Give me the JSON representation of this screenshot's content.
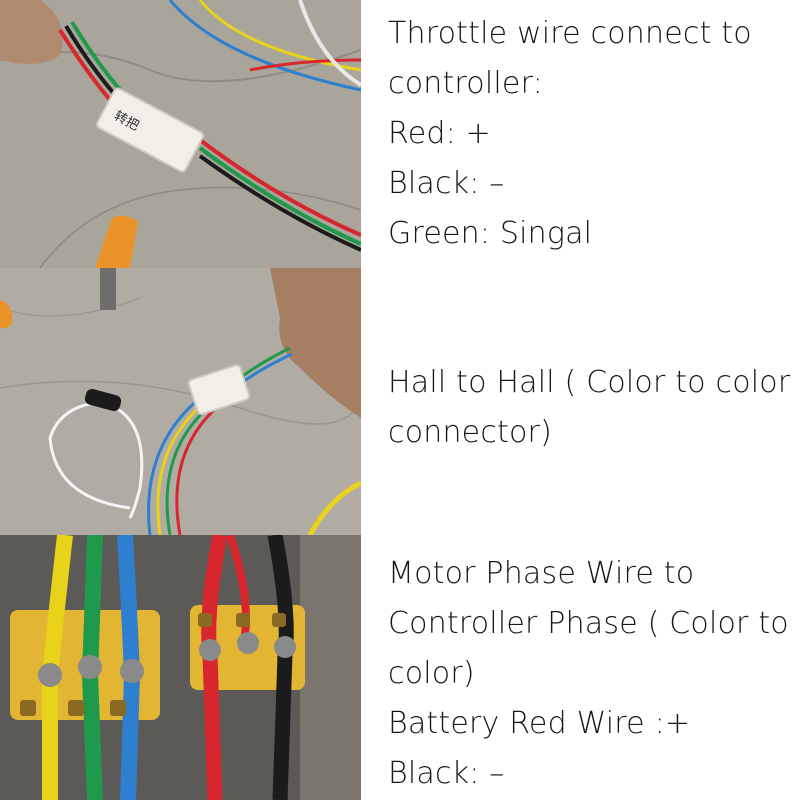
{
  "sections": [
    {
      "lines": [
        "Throttle wire connect to",
        "controller:",
        "Red: +",
        "Black: –",
        "Green: Singal"
      ],
      "photo_script_label": "转把"
    },
    {
      "lines": [
        "Hall to Hall ( Color to color",
        "connector)"
      ]
    },
    {
      "lines": [
        "Motor Phase Wire to",
        "Controller Phase ( Color to",
        "color)",
        "Battery Red Wire :+",
        "Black: –"
      ]
    }
  ],
  "colors": {
    "concrete": "#a8a49a",
    "wire_red": "#d8262e",
    "wire_black": "#1b1b1b",
    "wire_green": "#1f9a4c",
    "wire_blue": "#2f7fd0",
    "wire_yellow": "#e8d21a",
    "terminal_yellow": "#e2b532"
  }
}
